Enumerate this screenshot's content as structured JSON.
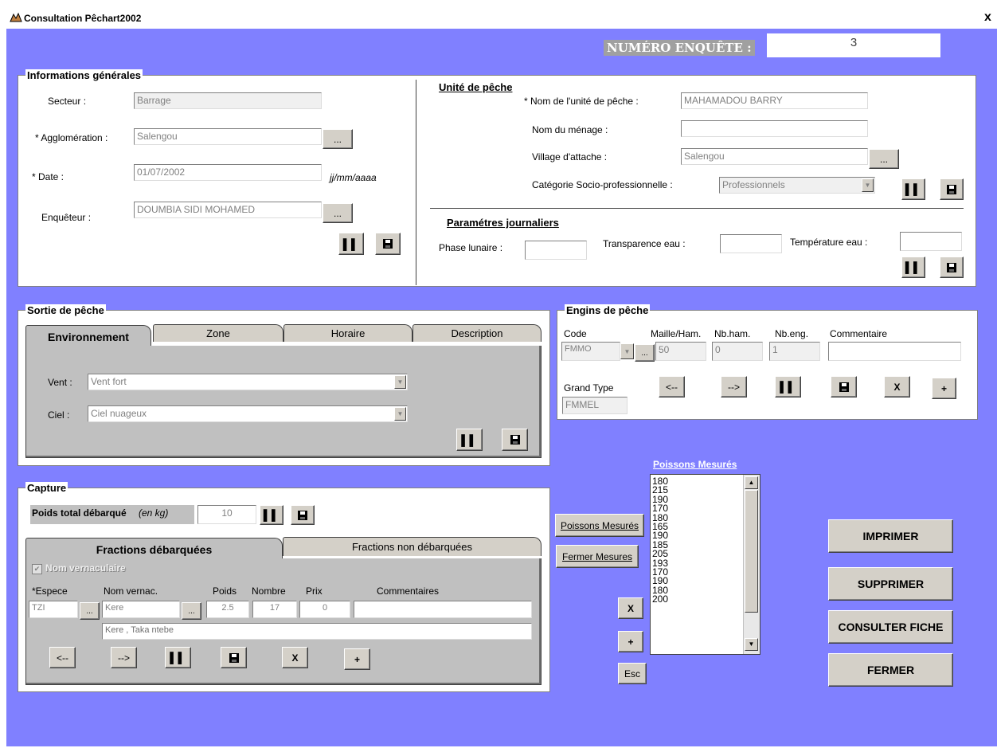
{
  "window": {
    "title": "Consultation Pêchart2002",
    "close": "x"
  },
  "header": {
    "enquete_label": "NUMÉRO ENQUÊTE :",
    "enquete_value": "3"
  },
  "infos": {
    "title": "Informations générales",
    "secteur_label": "Secteur :",
    "secteur_value": "Barrage",
    "agglo_label": "* Agglomération :",
    "agglo_value": "Salengou",
    "date_label": "* Date :",
    "date_value": "01/07/2002",
    "date_hint": "jj/mm/aaaa",
    "enqueteur_label": "Enquêteur :",
    "enqueteur_value": "DOUMBIA SIDI MOHAMED",
    "dots": "..."
  },
  "unite": {
    "title": "Unité de pêche",
    "nom_label": "* Nom de l'unité de pêche :",
    "nom_value": "MAHAMADOU BARRY",
    "menage_label": "Nom du ménage :",
    "menage_value": "",
    "village_label": "Village d'attache :",
    "village_value": "Salengou",
    "categorie_label": "Catégorie Socio-professionnelle :",
    "categorie_value": "Professionnels"
  },
  "params": {
    "title": "Paramétres journaliers",
    "phase_label": "Phase lunaire :",
    "phase_value": "",
    "transp_label": "Transparence eau :",
    "transp_value": "",
    "temp_label": "Température eau :",
    "temp_value": ""
  },
  "sortie": {
    "title": "Sortie de pêche",
    "tabs": [
      "Environnement",
      "Zone",
      "Horaire",
      "Description"
    ],
    "vent_label": "Vent :",
    "vent_value": "Vent fort",
    "ciel_label": "Ciel :",
    "ciel_value": "Ciel nuageux"
  },
  "engins": {
    "title": "Engins de pêche",
    "col_code": "Code",
    "col_maille": "Maille/Ham.",
    "col_nbham": "Nb.ham.",
    "col_nbeng": "Nb.eng.",
    "col_comment": "Commentaire",
    "code_value": "FMMO",
    "maille_value": "50",
    "nbham_value": "0",
    "nbeng_value": "1",
    "comment_value": "",
    "grand_type_label": "Grand Type",
    "grand_type_value": "FMMEL",
    "prev": "<--",
    "next": "-->",
    "del": "X",
    "add": "+"
  },
  "capture": {
    "title": "Capture",
    "poids_label": "Poids total débarqué",
    "poids_unit": "(en kg)",
    "poids_value": "10",
    "tabs": [
      "Fractions débarquées",
      "Fractions non débarquées"
    ],
    "nom_vern_check": "Nom vernaculaire",
    "col_espece": "*Espece",
    "col_nomvern": "Nom vernac.",
    "col_poids": "Poids",
    "col_nombre": "Nombre",
    "col_prix": "Prix",
    "col_comment": "Commentaires",
    "espece_value": "TZI",
    "nomvern_value": "Kere",
    "poids_row": "2.5",
    "nombre_row": "17",
    "prix_row": "0",
    "comment_row": "",
    "synonymes": "Kere , Taka ntebe",
    "prev": "<--",
    "next": "-->",
    "del": "X",
    "add": "+"
  },
  "mesures": {
    "title": "Poissons Mesurés",
    "btn_poissons": "Poissons Mesurés",
    "btn_fermer": "Fermer Mesures",
    "values": [
      "180",
      "215",
      "190",
      "170",
      "180",
      "165",
      "190",
      "185",
      "205",
      "193",
      "170",
      "190",
      "180",
      "200"
    ],
    "del": "X",
    "add": "+",
    "esc": "Esc"
  },
  "actions": {
    "imprimer": "IMPRIMER",
    "supprimer": "SUPPRIMER",
    "consulter": "CONSULTER FICHE",
    "fermer": "FERMER"
  },
  "icons": {
    "pause": "pause-icon",
    "save": "save-icon"
  },
  "colors": {
    "background": "#8080ff",
    "panel": "#ffffff",
    "button": "#d4d0c8",
    "tab_body": "#c0c0c0"
  }
}
